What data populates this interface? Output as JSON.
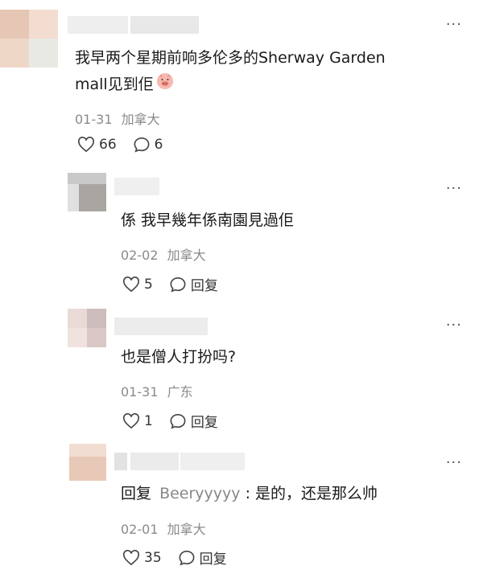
{
  "comments": [
    {
      "text_line1": "我早两个星期前响多伦多的Sherway Garden",
      "text_line2": "mall见到佢",
      "emoji": "pig-face-emoji",
      "date": "01-31",
      "location": "加拿大",
      "likes": "66",
      "replies": "6"
    },
    {
      "text": "係 我早幾年係南園見過佢",
      "date": "02-02",
      "location": "加拿大",
      "likes": "5",
      "reply_label": "回复"
    },
    {
      "text": "也是僧人打扮吗?",
      "date": "01-31",
      "location": "广东",
      "likes": "1",
      "reply_label": "回复"
    },
    {
      "reply_prefix": "回复",
      "reply_to": "Beeryyyyy",
      "text": ": 是的，还是那么帅",
      "date": "02-01",
      "location": "加拿大",
      "likes": "35",
      "reply_label": "回复"
    }
  ],
  "more_icon": "···"
}
